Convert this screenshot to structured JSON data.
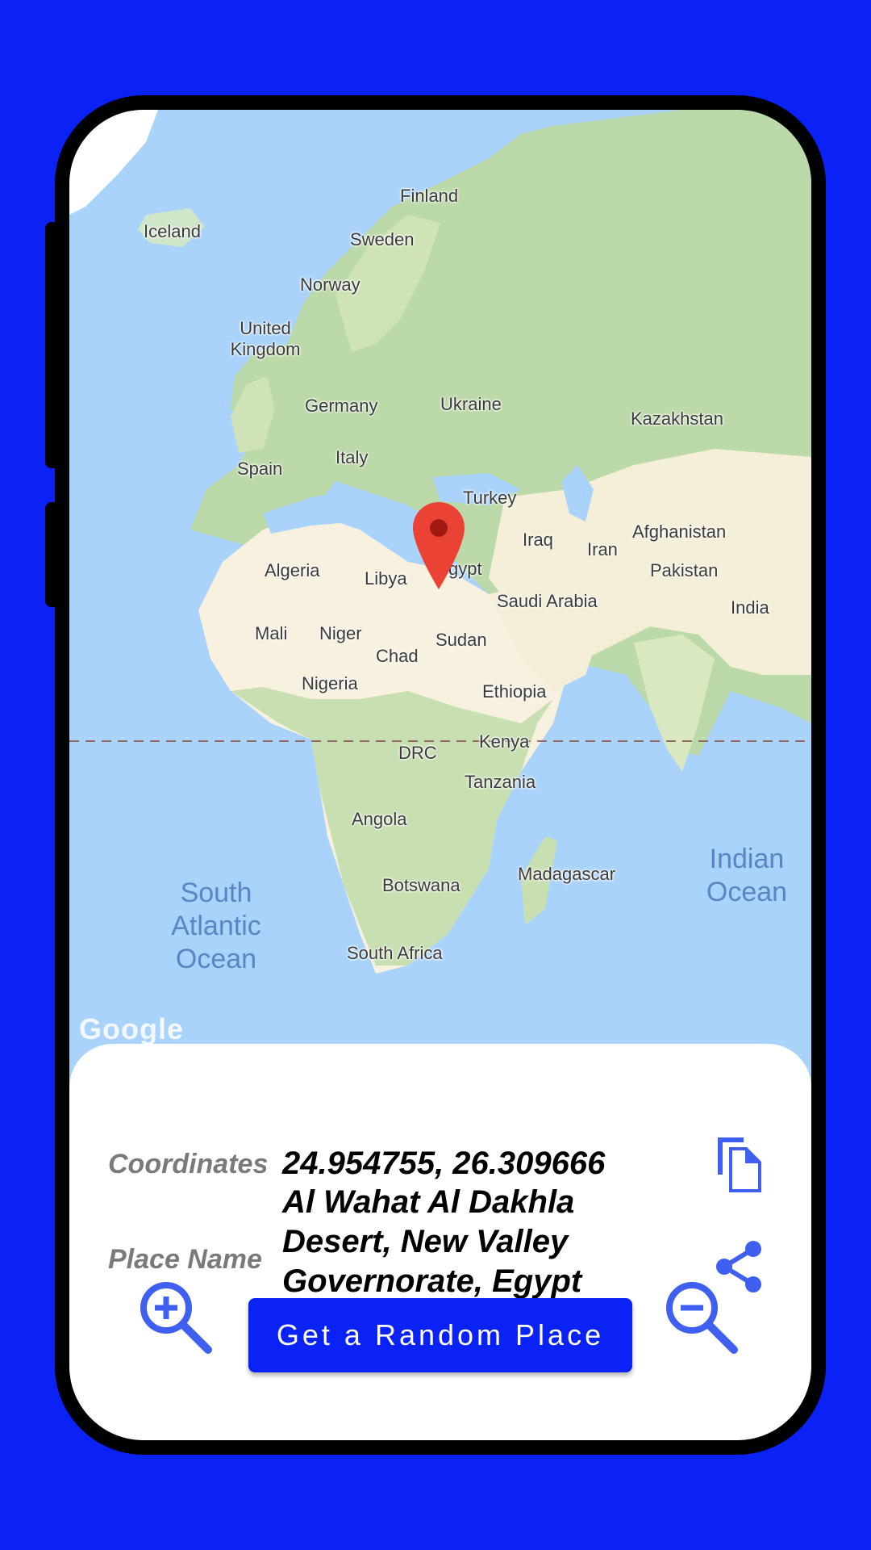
{
  "map": {
    "countries": [
      "Finland",
      "Iceland",
      "Sweden",
      "Norway",
      "United Kingdom",
      "Germany",
      "Ukraine",
      "Kazakhstan",
      "Spain",
      "Italy",
      "Turkey",
      "Iraq",
      "Iran",
      "Afghanistan",
      "Pakistan",
      "Algeria",
      "Libya",
      "Egypt",
      "Saudi Arabia",
      "India",
      "Mali",
      "Niger",
      "Sudan",
      "Chad",
      "Nigeria",
      "Ethiopia",
      "Kenya",
      "DRC",
      "Tanzania",
      "Angola",
      "Madagascar",
      "Botswana",
      "South Africa"
    ],
    "oceans": [
      "South Atlantic Ocean",
      "Indian Ocean"
    ],
    "egypt_visible": "gypt",
    "attribution": "Google",
    "pin_icon": "map-pin-icon",
    "pin_color": "#ea4335"
  },
  "info": {
    "coordinates_label": "Coordinates",
    "coordinates_value": "24.954755, 26.309666",
    "place_label": "Place Name",
    "place_value": "Al Wahat Al Dakhla Desert, New Valley Governorate, Egypt",
    "copy_icon": "copy-icon",
    "share_icon": "share-icon"
  },
  "controls": {
    "zoom_in_icon": "zoom-in-icon",
    "random_button": "Get a Random Place",
    "zoom_out_icon": "zoom-out-icon",
    "accent": "#0a22f5",
    "icon_color": "#3f5ff0"
  }
}
